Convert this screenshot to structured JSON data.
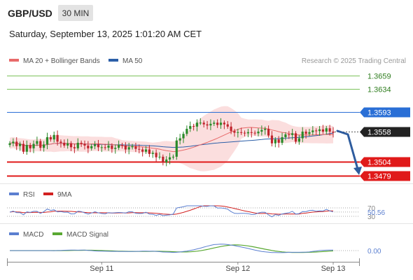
{
  "header": {
    "pair": "GBP/USD",
    "timeframe": "30 MIN",
    "datetime": "Saturday, September 13, 2025 1:01:20 AM CET"
  },
  "legend": {
    "ma20": "MA 20 + Bollinger Bands",
    "ma50": "MA 50",
    "credit": "Research © 2025 Trading Central",
    "rsi": "RSI",
    "rsi_ma": "9MA",
    "macd": "MACD",
    "macd_signal": "MACD Signal"
  },
  "colors": {
    "up": "#2a8a2a",
    "down": "#c0242d",
    "ma20": "#e86a6a",
    "ma50": "#2c5fa8",
    "band": "#f7c3c3",
    "resistance": "#7cc35b",
    "pivot": "#2a6fd6",
    "support": "#e01a1a",
    "last": "#222222",
    "rsi": "#5b7fd0",
    "rsi_ma": "#d22020",
    "macd": "#5b7fd0",
    "macd_signal": "#59a832",
    "arrow": "#2e5c9e"
  },
  "chart_data": [
    {
      "type": "candlestick",
      "x_ticks": [
        "Sep 11",
        "Sep 12",
        "Sep 13"
      ],
      "levels": [
        {
          "label": "1.3659",
          "value": 1.3659,
          "kind": "resistance"
        },
        {
          "label": "1.3634",
          "value": 1.3634,
          "kind": "resistance"
        },
        {
          "label": "1.3593",
          "value": 1.3593,
          "kind": "pivot"
        },
        {
          "label": "1.3504",
          "value": 1.3504,
          "kind": "support"
        },
        {
          "label": "1.3479",
          "value": 1.3479,
          "kind": "support"
        }
      ],
      "last_price": {
        "label": "1.3558",
        "value": 1.3558
      },
      "close": [
        1.3537,
        1.354,
        1.3532,
        1.3536,
        1.3522,
        1.3534,
        1.3528,
        1.3536,
        1.3541,
        1.3529,
        1.3535,
        1.3548,
        1.3544,
        1.3552,
        1.354,
        1.3538,
        1.3533,
        1.3537,
        1.353,
        1.3528,
        1.3538,
        1.3536,
        1.3533,
        1.3528,
        1.3532,
        1.3535,
        1.353,
        1.353,
        1.3529,
        1.3533,
        1.3527,
        1.3529,
        1.3534,
        1.3533,
        1.3526,
        1.353,
        1.3532,
        1.3527,
        1.3526,
        1.3522,
        1.3526,
        1.3518,
        1.352,
        1.3512,
        1.3513,
        1.3503,
        1.3508,
        1.3512,
        1.3513,
        1.3542,
        1.3546,
        1.3554,
        1.3563,
        1.3568,
        1.3567,
        1.3574,
        1.3574,
        1.3571,
        1.3569,
        1.3572,
        1.3574,
        1.357,
        1.3574,
        1.3571,
        1.3567,
        1.3559,
        1.3556,
        1.3557,
        1.3556,
        1.3555,
        1.3557,
        1.3556,
        1.3555,
        1.3558,
        1.3561,
        1.3563,
        1.3551,
        1.3537,
        1.3544,
        1.3538,
        1.3548,
        1.3553,
        1.3552,
        1.3555,
        1.354,
        1.3546,
        1.3558,
        1.3554,
        1.3557,
        1.356,
        1.3559,
        1.3562,
        1.3558,
        1.3564,
        1.3558,
        1.3556
      ],
      "rsi": {
        "levels": [
          70,
          30
        ],
        "last": 50.56
      },
      "macd": {
        "last": 0.0
      }
    }
  ]
}
